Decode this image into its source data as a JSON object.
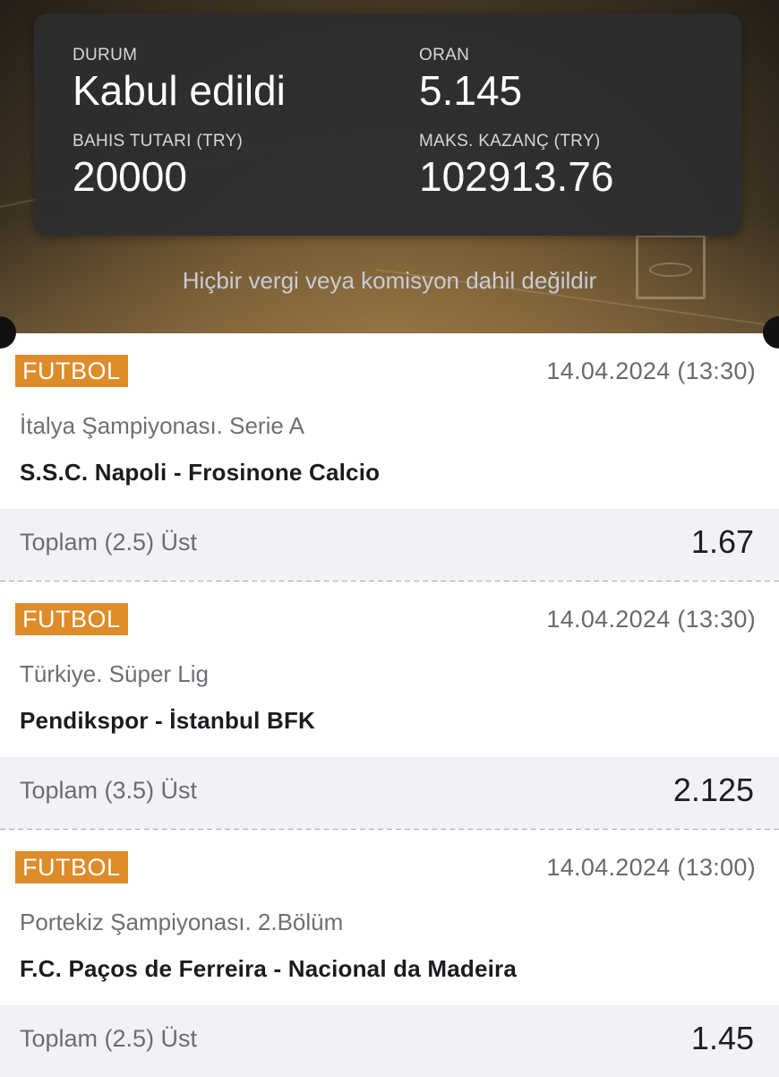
{
  "summary": {
    "status_label": "DURUM",
    "status_value": "Kabul edildi",
    "odds_label": "ORAN",
    "odds_value": "5.145",
    "stake_label": "BAHIS TUTARI (TRY)",
    "stake_value": "20000",
    "max_win_label": "MAKS. KAZANÇ (TRY)",
    "max_win_value": "102913.76",
    "tax_note": "Hiçbir vergi veya komisyon dahil değildir"
  },
  "bets": [
    {
      "sport": "FUTBOL",
      "datetime": "14.04.2024 (13:30)",
      "league": "İtalya Şampiyonası. Serie A",
      "match": "S.S.C. Napoli - Frosinone Calcio",
      "market": "Toplam (2.5) Üst",
      "odd": "1.67"
    },
    {
      "sport": "FUTBOL",
      "datetime": "14.04.2024 (13:30)",
      "league": "Türkiye. Süper Lig",
      "match": "Pendikspor - İstanbul BFK",
      "market": "Toplam (3.5) Üst",
      "odd": "2.125"
    },
    {
      "sport": "FUTBOL",
      "datetime": "14.04.2024 (13:00)",
      "league": "Portekiz Şampiyonası. 2.Bölüm",
      "match": "F.C. Paços de Ferreira - Nacional da Madeira",
      "market": "Toplam (2.5) Üst",
      "odd": "1.45"
    }
  ],
  "colors": {
    "badge": "#de8c2a",
    "card": "#2d2d30",
    "selection_bg": "#f2f2f6"
  }
}
